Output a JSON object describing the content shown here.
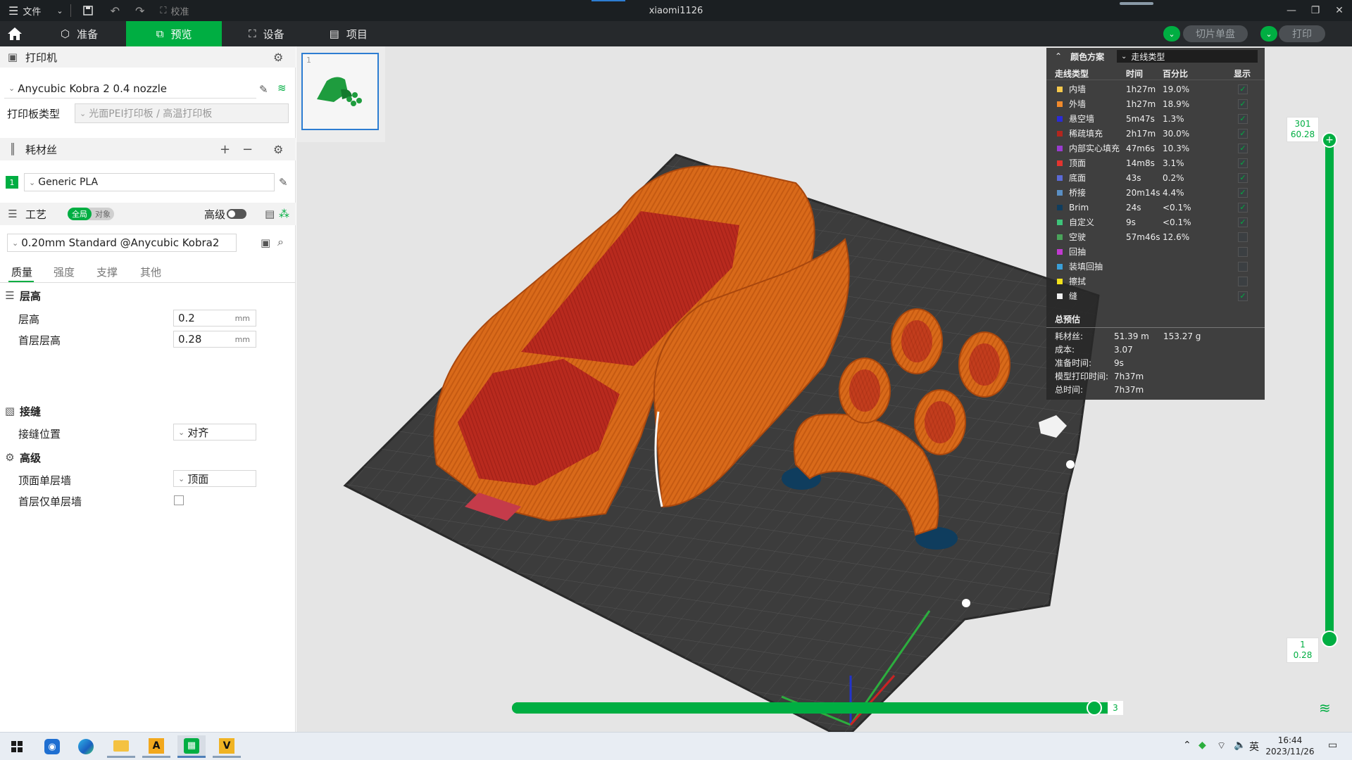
{
  "titlebar": {
    "menu_label": "文件",
    "calibrate_label": "校准",
    "title": "xiaomi1126"
  },
  "tabs": [
    {
      "label": "准备"
    },
    {
      "label": "预览"
    },
    {
      "label": "设备"
    },
    {
      "label": "项目"
    }
  ],
  "actions": {
    "slice_label": "切片单盘",
    "print_label": "打印"
  },
  "left": {
    "printer_header": "打印机",
    "printer_name": "Anycubic Kobra 2 0.4 nozzle",
    "plate_type_label": "打印板类型",
    "plate_type_value": "光面PEI打印板 / 高温打印板",
    "filament_header": "耗材丝",
    "filament_index": "1",
    "filament_name": "Generic PLA",
    "process_header": "工艺",
    "toggle_global": "全局",
    "toggle_object": "对象",
    "advanced_label": "高级",
    "profile_name": "0.20mm Standard @Anycubic Kobra2",
    "subtabs": [
      {
        "label": "质量"
      },
      {
        "label": "强度"
      },
      {
        "label": "支撑"
      },
      {
        "label": "其他"
      }
    ],
    "group_layer": "层高",
    "layer_height_label": "层高",
    "layer_height_value": "0.2",
    "first_layer_label": "首层层高",
    "first_layer_value": "0.28",
    "unit_mm": "mm",
    "group_seam": "接缝",
    "seam_pos_label": "接缝位置",
    "seam_pos_value": "对齐",
    "group_advanced": "高级",
    "top_single_label": "顶面单层墙",
    "top_single_value": "顶面",
    "first_single_label": "首层仅单层墙"
  },
  "plate_thumb": {
    "number": "1"
  },
  "legend": {
    "scheme_label": "颜色方案",
    "scheme_value": "走线类型",
    "col_type": "走线类型",
    "col_time": "时间",
    "col_pct": "百分比",
    "col_show": "显示",
    "rows": [
      {
        "name": "内墙",
        "time": "1h27m",
        "pct": "19.0%",
        "color": "#f5c84c",
        "shown": true
      },
      {
        "name": "外墙",
        "time": "1h27m",
        "pct": "18.9%",
        "color": "#f08a2c",
        "shown": true
      },
      {
        "name": "悬空墙",
        "time": "5m47s",
        "pct": "1.3%",
        "color": "#2b2bd6",
        "shown": true
      },
      {
        "name": "稀疏填充",
        "time": "2h17m",
        "pct": "30.0%",
        "color": "#b3261e",
        "shown": true
      },
      {
        "name": "内部实心填充",
        "time": "47m6s",
        "pct": "10.3%",
        "color": "#9a3bd0",
        "shown": true
      },
      {
        "name": "顶面",
        "time": "14m8s",
        "pct": "3.1%",
        "color": "#e3342f",
        "shown": true
      },
      {
        "name": "底面",
        "time": "43s",
        "pct": "0.2%",
        "color": "#5b6ad6",
        "shown": true
      },
      {
        "name": "桥接",
        "time": "20m14s",
        "pct": "4.4%",
        "color": "#5a8fc4",
        "shown": true
      },
      {
        "name": "Brim",
        "time": "24s",
        "pct": "<0.1%",
        "color": "#0f3d5e",
        "shown": true
      },
      {
        "name": "自定义",
        "time": "9s",
        "pct": "<0.1%",
        "color": "#3ec47a",
        "shown": true
      },
      {
        "name": "空驶",
        "time": "57m46s",
        "pct": "12.6%",
        "color": "#4aa35a",
        "shown": false
      },
      {
        "name": "回抽",
        "time": "",
        "pct": "",
        "color": "#c23ad1",
        "shown": false
      },
      {
        "name": "装填回抽",
        "time": "",
        "pct": "",
        "color": "#3a9fd8",
        "shown": false
      },
      {
        "name": "擦拭",
        "time": "",
        "pct": "",
        "color": "#f2e11c",
        "shown": false
      },
      {
        "name": "缝",
        "time": "",
        "pct": "",
        "color": "#f0f0f0",
        "shown": true
      }
    ],
    "summary_title": "总预估",
    "summary": [
      {
        "label": "耗材丝:",
        "value": "51.39 m",
        "value2": "153.27 g"
      },
      {
        "label": "成本:",
        "value": "3.07",
        "value2": ""
      },
      {
        "label": "准备时间:",
        "value": "9s",
        "value2": ""
      },
      {
        "label": "模型打印时间:",
        "value": "7h37m",
        "value2": ""
      },
      {
        "label": "总时间:",
        "value": "7h37m",
        "value2": ""
      }
    ]
  },
  "vslider": {
    "top_layer": "301",
    "top_height": "60.28",
    "bottom_layer": "1",
    "bottom_height": "0.28",
    "fill_fraction": 1.0
  },
  "hslider": {
    "value": "3",
    "fill_fraction": 1.0
  },
  "taskbar": {
    "time": "16:44",
    "date": "2023/11/26",
    "ime": "英"
  },
  "colors": {
    "accent": "#00ae42",
    "model_orange": "#d96a1a",
    "model_red": "#b3261e",
    "bed": "#3c3c3c"
  }
}
